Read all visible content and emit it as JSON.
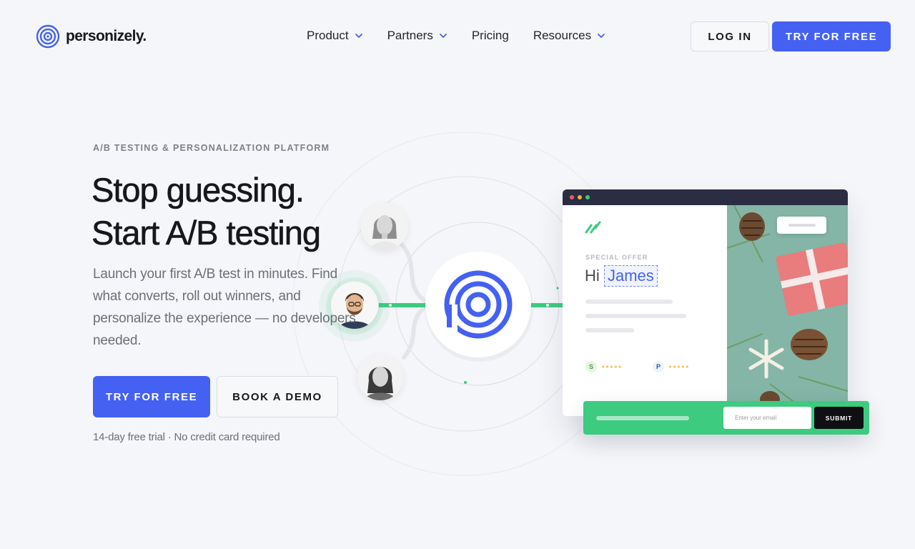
{
  "brand": {
    "name": "personizely.",
    "accent": "#4461f2",
    "green": "#3ccb7f"
  },
  "nav": {
    "items": [
      {
        "label": "Product",
        "has_dropdown": true
      },
      {
        "label": "Partners",
        "has_dropdown": true
      },
      {
        "label": "Pricing",
        "has_dropdown": false
      },
      {
        "label": "Resources",
        "has_dropdown": true
      }
    ],
    "login_label": "LOG IN",
    "try_label": "TRY FOR FREE"
  },
  "hero": {
    "eyebrow": "A/B TESTING & PERSONALIZATION PLATFORM",
    "headline_line1": "Stop guessing.",
    "headline_line2": "Start A/B testing",
    "subtext": "Launch your first A/B test in minutes. Find what converts, roll out winners, and personalize the experience — no developers needed.",
    "primary_cta": "TRY FOR FREE",
    "secondary_cta": "BOOK A DEMO",
    "trial_note": "14-day free trial · No credit card required"
  },
  "mockup": {
    "special_offer": "SPECIAL OFFER",
    "greeting": "Hi",
    "name": "James",
    "email_placeholder": "Enter your email",
    "submit_label": "SUBMIT",
    "window_dots": [
      "#ef5a5a",
      "#f2b23b",
      "#3ccb7f"
    ]
  },
  "icons": {
    "logo": "concentric-circles-logo",
    "chevron": "chevron-down-icon",
    "hub": "personizely-p-icon"
  }
}
